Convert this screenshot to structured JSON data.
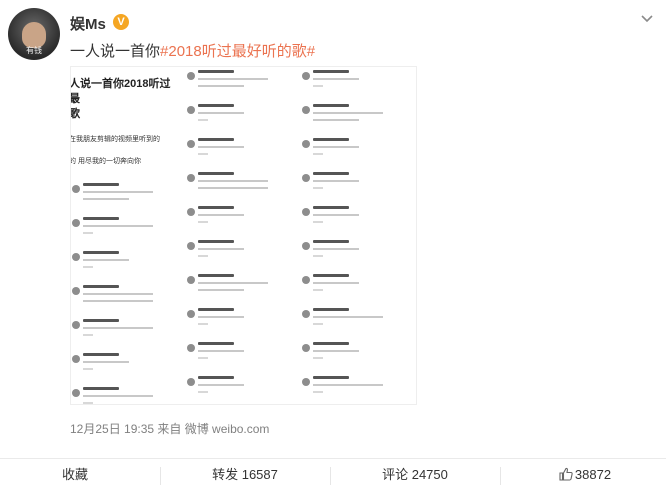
{
  "post": {
    "username": "娱Ms",
    "verified_badge": "V",
    "avatar_caption": "有钱",
    "text_prefix": "一人说一首你",
    "hashtag": "#2018听过最好听的歌#",
    "timestamp": "12月25日 19:35 来自 微博 weibo.com"
  },
  "screenshot": {
    "title_line1": "人说一首你2018听过最",
    "title_line2": "歌",
    "line1": "在我朋友剪辑的视频里听到的",
    "line2": "的  用尽我的一切奔向你"
  },
  "actions": {
    "favorite": "收藏",
    "repost": "转发 16587",
    "comment": "评论 24750",
    "like": "38872"
  },
  "colors": {
    "hashtag": "#eb7350",
    "badge": "#f5a623",
    "meta_text": "#808080"
  },
  "icons": {
    "menu": "chevron-down-icon",
    "like": "thumbs-up-icon"
  }
}
